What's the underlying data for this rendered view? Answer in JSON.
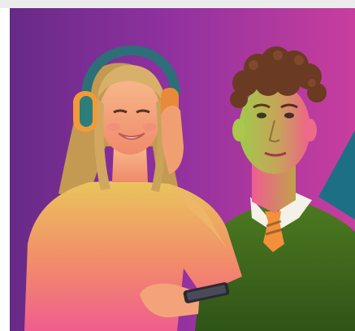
{
  "image": {
    "description_hidden": true,
    "colors": {
      "background_left": "#6a2a8a",
      "background_right": "#c13c9e",
      "teal_shape": "#1d6f86",
      "sweater_yellow": "#e9c55b",
      "sweater_pink": "#ef5d8f",
      "skin_warm": "#f2a070",
      "hair_blonde": "#caa25a",
      "boy_hair": "#6b3a22",
      "boy_skin_green": "#a6c64b",
      "boy_skin_pink": "#f0608a",
      "vest_green": "#3e6a1e",
      "shirt_white": "#f4f1e6",
      "headphone_orange": "#f29a3a",
      "headphone_teal": "#2d7d7a"
    },
    "icons": [
      "headphones-icon",
      "smartphone-icon"
    ]
  }
}
